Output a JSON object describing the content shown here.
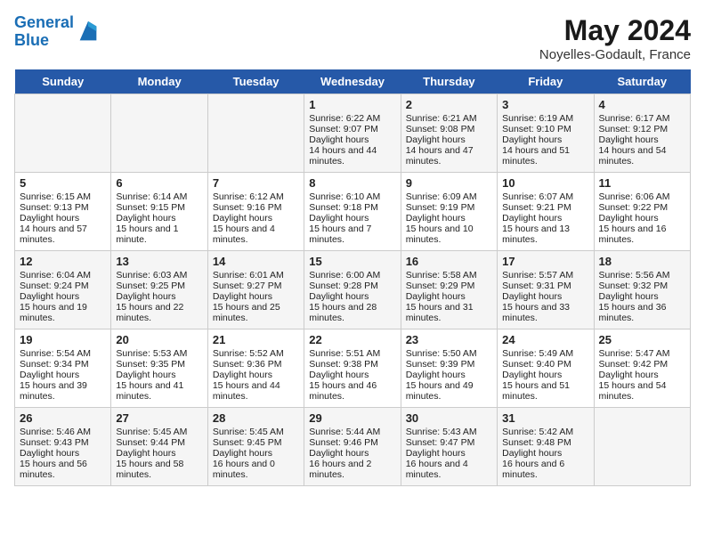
{
  "header": {
    "logo_line1": "General",
    "logo_line2": "Blue",
    "month_title": "May 2024",
    "location": "Noyelles-Godault, France"
  },
  "days_of_week": [
    "Sunday",
    "Monday",
    "Tuesday",
    "Wednesday",
    "Thursday",
    "Friday",
    "Saturday"
  ],
  "weeks": [
    {
      "cells": [
        {
          "day": null,
          "content": null
        },
        {
          "day": null,
          "content": null
        },
        {
          "day": null,
          "content": null
        },
        {
          "day": "1",
          "sunrise": "6:22 AM",
          "sunset": "9:07 PM",
          "daylight": "14 hours and 44 minutes."
        },
        {
          "day": "2",
          "sunrise": "6:21 AM",
          "sunset": "9:08 PM",
          "daylight": "14 hours and 47 minutes."
        },
        {
          "day": "3",
          "sunrise": "6:19 AM",
          "sunset": "9:10 PM",
          "daylight": "14 hours and 51 minutes."
        },
        {
          "day": "4",
          "sunrise": "6:17 AM",
          "sunset": "9:12 PM",
          "daylight": "14 hours and 54 minutes."
        }
      ]
    },
    {
      "cells": [
        {
          "day": "5",
          "sunrise": "6:15 AM",
          "sunset": "9:13 PM",
          "daylight": "14 hours and 57 minutes."
        },
        {
          "day": "6",
          "sunrise": "6:14 AM",
          "sunset": "9:15 PM",
          "daylight": "15 hours and 1 minute."
        },
        {
          "day": "7",
          "sunrise": "6:12 AM",
          "sunset": "9:16 PM",
          "daylight": "15 hours and 4 minutes."
        },
        {
          "day": "8",
          "sunrise": "6:10 AM",
          "sunset": "9:18 PM",
          "daylight": "15 hours and 7 minutes."
        },
        {
          "day": "9",
          "sunrise": "6:09 AM",
          "sunset": "9:19 PM",
          "daylight": "15 hours and 10 minutes."
        },
        {
          "day": "10",
          "sunrise": "6:07 AM",
          "sunset": "9:21 PM",
          "daylight": "15 hours and 13 minutes."
        },
        {
          "day": "11",
          "sunrise": "6:06 AM",
          "sunset": "9:22 PM",
          "daylight": "15 hours and 16 minutes."
        }
      ]
    },
    {
      "cells": [
        {
          "day": "12",
          "sunrise": "6:04 AM",
          "sunset": "9:24 PM",
          "daylight": "15 hours and 19 minutes."
        },
        {
          "day": "13",
          "sunrise": "6:03 AM",
          "sunset": "9:25 PM",
          "daylight": "15 hours and 22 minutes."
        },
        {
          "day": "14",
          "sunrise": "6:01 AM",
          "sunset": "9:27 PM",
          "daylight": "15 hours and 25 minutes."
        },
        {
          "day": "15",
          "sunrise": "6:00 AM",
          "sunset": "9:28 PM",
          "daylight": "15 hours and 28 minutes."
        },
        {
          "day": "16",
          "sunrise": "5:58 AM",
          "sunset": "9:29 PM",
          "daylight": "15 hours and 31 minutes."
        },
        {
          "day": "17",
          "sunrise": "5:57 AM",
          "sunset": "9:31 PM",
          "daylight": "15 hours and 33 minutes."
        },
        {
          "day": "18",
          "sunrise": "5:56 AM",
          "sunset": "9:32 PM",
          "daylight": "15 hours and 36 minutes."
        }
      ]
    },
    {
      "cells": [
        {
          "day": "19",
          "sunrise": "5:54 AM",
          "sunset": "9:34 PM",
          "daylight": "15 hours and 39 minutes."
        },
        {
          "day": "20",
          "sunrise": "5:53 AM",
          "sunset": "9:35 PM",
          "daylight": "15 hours and 41 minutes."
        },
        {
          "day": "21",
          "sunrise": "5:52 AM",
          "sunset": "9:36 PM",
          "daylight": "15 hours and 44 minutes."
        },
        {
          "day": "22",
          "sunrise": "5:51 AM",
          "sunset": "9:38 PM",
          "daylight": "15 hours and 46 minutes."
        },
        {
          "day": "23",
          "sunrise": "5:50 AM",
          "sunset": "9:39 PM",
          "daylight": "15 hours and 49 minutes."
        },
        {
          "day": "24",
          "sunrise": "5:49 AM",
          "sunset": "9:40 PM",
          "daylight": "15 hours and 51 minutes."
        },
        {
          "day": "25",
          "sunrise": "5:47 AM",
          "sunset": "9:42 PM",
          "daylight": "15 hours and 54 minutes."
        }
      ]
    },
    {
      "cells": [
        {
          "day": "26",
          "sunrise": "5:46 AM",
          "sunset": "9:43 PM",
          "daylight": "15 hours and 56 minutes."
        },
        {
          "day": "27",
          "sunrise": "5:45 AM",
          "sunset": "9:44 PM",
          "daylight": "15 hours and 58 minutes."
        },
        {
          "day": "28",
          "sunrise": "5:45 AM",
          "sunset": "9:45 PM",
          "daylight": "16 hours and 0 minutes."
        },
        {
          "day": "29",
          "sunrise": "5:44 AM",
          "sunset": "9:46 PM",
          "daylight": "16 hours and 2 minutes."
        },
        {
          "day": "30",
          "sunrise": "5:43 AM",
          "sunset": "9:47 PM",
          "daylight": "16 hours and 4 minutes."
        },
        {
          "day": "31",
          "sunrise": "5:42 AM",
          "sunset": "9:48 PM",
          "daylight": "16 hours and 6 minutes."
        },
        {
          "day": null,
          "content": null
        }
      ]
    }
  ]
}
